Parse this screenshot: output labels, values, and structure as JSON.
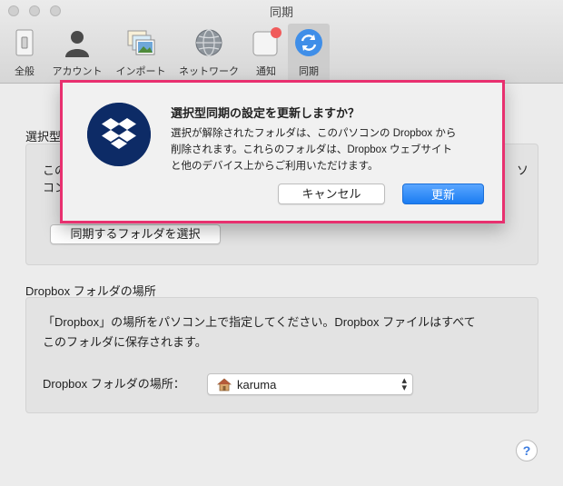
{
  "window": {
    "title": "同期"
  },
  "toolbar": {
    "items": [
      {
        "label": "全般",
        "icon": "switch-icon"
      },
      {
        "label": "アカウント",
        "icon": "person-icon"
      },
      {
        "label": "インポート",
        "icon": "photos-icon"
      },
      {
        "label": "ネットワーク",
        "icon": "globe-icon"
      },
      {
        "label": "通知",
        "icon": "notification-icon"
      },
      {
        "label": "同期",
        "icon": "sync-icon"
      }
    ]
  },
  "selective_sync": {
    "section_title_visible": "選択型",
    "text_line1_visible": "この",
    "text_line1_end_visible": "ソ",
    "text_line2_visible": "コン",
    "button_label": "同期するフォルダを選択"
  },
  "dropbox_folder": {
    "section_title": "Dropbox フォルダの場所",
    "description_line1": "「Dropbox」の場所をパソコン上で指定してください。Dropbox ファイルはすべて",
    "description_line2": "このフォルダに保存されます。",
    "location_label": "Dropbox フォルダの場所：",
    "location_value": "karuma"
  },
  "dialog": {
    "title": "選択型同期の設定を更新しますか？",
    "message_line1": "選択が解除されたフォルダは、このパソコンの Dropbox から",
    "message_line2": "削除されます。これらのフォルダは、Dropbox ウェブサイト",
    "message_line3": "と他のデバイス上からご利用いただけます。",
    "cancel_label": "キャンセル",
    "update_label": "更新",
    "highlight_color": "#e8306f"
  },
  "help": {
    "label": "?"
  }
}
